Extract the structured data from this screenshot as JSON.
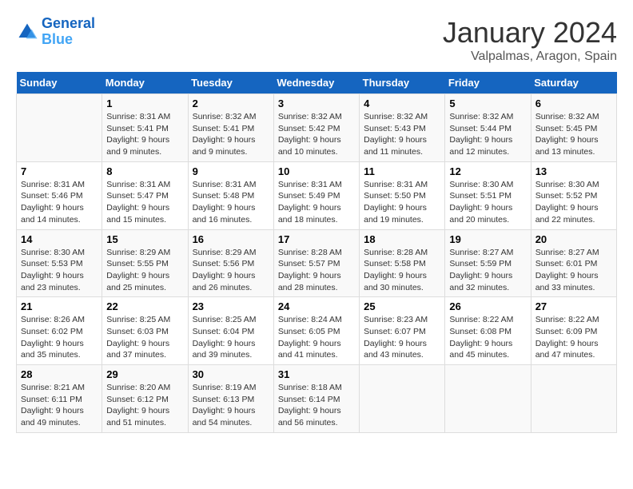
{
  "header": {
    "logo_line1": "General",
    "logo_line2": "Blue",
    "month_title": "January 2024",
    "subtitle": "Valpalmas, Aragon, Spain"
  },
  "weekdays": [
    "Sunday",
    "Monday",
    "Tuesday",
    "Wednesday",
    "Thursday",
    "Friday",
    "Saturday"
  ],
  "weeks": [
    [
      {
        "day": "",
        "sunrise": "",
        "sunset": "",
        "daylight": ""
      },
      {
        "day": "1",
        "sunrise": "Sunrise: 8:31 AM",
        "sunset": "Sunset: 5:41 PM",
        "daylight": "Daylight: 9 hours and 9 minutes."
      },
      {
        "day": "2",
        "sunrise": "Sunrise: 8:32 AM",
        "sunset": "Sunset: 5:41 PM",
        "daylight": "Daylight: 9 hours and 9 minutes."
      },
      {
        "day": "3",
        "sunrise": "Sunrise: 8:32 AM",
        "sunset": "Sunset: 5:42 PM",
        "daylight": "Daylight: 9 hours and 10 minutes."
      },
      {
        "day": "4",
        "sunrise": "Sunrise: 8:32 AM",
        "sunset": "Sunset: 5:43 PM",
        "daylight": "Daylight: 9 hours and 11 minutes."
      },
      {
        "day": "5",
        "sunrise": "Sunrise: 8:32 AM",
        "sunset": "Sunset: 5:44 PM",
        "daylight": "Daylight: 9 hours and 12 minutes."
      },
      {
        "day": "6",
        "sunrise": "Sunrise: 8:32 AM",
        "sunset": "Sunset: 5:45 PM",
        "daylight": "Daylight: 9 hours and 13 minutes."
      }
    ],
    [
      {
        "day": "7",
        "sunrise": "Sunrise: 8:31 AM",
        "sunset": "Sunset: 5:46 PM",
        "daylight": "Daylight: 9 hours and 14 minutes."
      },
      {
        "day": "8",
        "sunrise": "Sunrise: 8:31 AM",
        "sunset": "Sunset: 5:47 PM",
        "daylight": "Daylight: 9 hours and 15 minutes."
      },
      {
        "day": "9",
        "sunrise": "Sunrise: 8:31 AM",
        "sunset": "Sunset: 5:48 PM",
        "daylight": "Daylight: 9 hours and 16 minutes."
      },
      {
        "day": "10",
        "sunrise": "Sunrise: 8:31 AM",
        "sunset": "Sunset: 5:49 PM",
        "daylight": "Daylight: 9 hours and 18 minutes."
      },
      {
        "day": "11",
        "sunrise": "Sunrise: 8:31 AM",
        "sunset": "Sunset: 5:50 PM",
        "daylight": "Daylight: 9 hours and 19 minutes."
      },
      {
        "day": "12",
        "sunrise": "Sunrise: 8:30 AM",
        "sunset": "Sunset: 5:51 PM",
        "daylight": "Daylight: 9 hours and 20 minutes."
      },
      {
        "day": "13",
        "sunrise": "Sunrise: 8:30 AM",
        "sunset": "Sunset: 5:52 PM",
        "daylight": "Daylight: 9 hours and 22 minutes."
      }
    ],
    [
      {
        "day": "14",
        "sunrise": "Sunrise: 8:30 AM",
        "sunset": "Sunset: 5:53 PM",
        "daylight": "Daylight: 9 hours and 23 minutes."
      },
      {
        "day": "15",
        "sunrise": "Sunrise: 8:29 AM",
        "sunset": "Sunset: 5:55 PM",
        "daylight": "Daylight: 9 hours and 25 minutes."
      },
      {
        "day": "16",
        "sunrise": "Sunrise: 8:29 AM",
        "sunset": "Sunset: 5:56 PM",
        "daylight": "Daylight: 9 hours and 26 minutes."
      },
      {
        "day": "17",
        "sunrise": "Sunrise: 8:28 AM",
        "sunset": "Sunset: 5:57 PM",
        "daylight": "Daylight: 9 hours and 28 minutes."
      },
      {
        "day": "18",
        "sunrise": "Sunrise: 8:28 AM",
        "sunset": "Sunset: 5:58 PM",
        "daylight": "Daylight: 9 hours and 30 minutes."
      },
      {
        "day": "19",
        "sunrise": "Sunrise: 8:27 AM",
        "sunset": "Sunset: 5:59 PM",
        "daylight": "Daylight: 9 hours and 32 minutes."
      },
      {
        "day": "20",
        "sunrise": "Sunrise: 8:27 AM",
        "sunset": "Sunset: 6:01 PM",
        "daylight": "Daylight: 9 hours and 33 minutes."
      }
    ],
    [
      {
        "day": "21",
        "sunrise": "Sunrise: 8:26 AM",
        "sunset": "Sunset: 6:02 PM",
        "daylight": "Daylight: 9 hours and 35 minutes."
      },
      {
        "day": "22",
        "sunrise": "Sunrise: 8:25 AM",
        "sunset": "Sunset: 6:03 PM",
        "daylight": "Daylight: 9 hours and 37 minutes."
      },
      {
        "day": "23",
        "sunrise": "Sunrise: 8:25 AM",
        "sunset": "Sunset: 6:04 PM",
        "daylight": "Daylight: 9 hours and 39 minutes."
      },
      {
        "day": "24",
        "sunrise": "Sunrise: 8:24 AM",
        "sunset": "Sunset: 6:05 PM",
        "daylight": "Daylight: 9 hours and 41 minutes."
      },
      {
        "day": "25",
        "sunrise": "Sunrise: 8:23 AM",
        "sunset": "Sunset: 6:07 PM",
        "daylight": "Daylight: 9 hours and 43 minutes."
      },
      {
        "day": "26",
        "sunrise": "Sunrise: 8:22 AM",
        "sunset": "Sunset: 6:08 PM",
        "daylight": "Daylight: 9 hours and 45 minutes."
      },
      {
        "day": "27",
        "sunrise": "Sunrise: 8:22 AM",
        "sunset": "Sunset: 6:09 PM",
        "daylight": "Daylight: 9 hours and 47 minutes."
      }
    ],
    [
      {
        "day": "28",
        "sunrise": "Sunrise: 8:21 AM",
        "sunset": "Sunset: 6:11 PM",
        "daylight": "Daylight: 9 hours and 49 minutes."
      },
      {
        "day": "29",
        "sunrise": "Sunrise: 8:20 AM",
        "sunset": "Sunset: 6:12 PM",
        "daylight": "Daylight: 9 hours and 51 minutes."
      },
      {
        "day": "30",
        "sunrise": "Sunrise: 8:19 AM",
        "sunset": "Sunset: 6:13 PM",
        "daylight": "Daylight: 9 hours and 54 minutes."
      },
      {
        "day": "31",
        "sunrise": "Sunrise: 8:18 AM",
        "sunset": "Sunset: 6:14 PM",
        "daylight": "Daylight: 9 hours and 56 minutes."
      },
      {
        "day": "",
        "sunrise": "",
        "sunset": "",
        "daylight": ""
      },
      {
        "day": "",
        "sunrise": "",
        "sunset": "",
        "daylight": ""
      },
      {
        "day": "",
        "sunrise": "",
        "sunset": "",
        "daylight": ""
      }
    ]
  ]
}
